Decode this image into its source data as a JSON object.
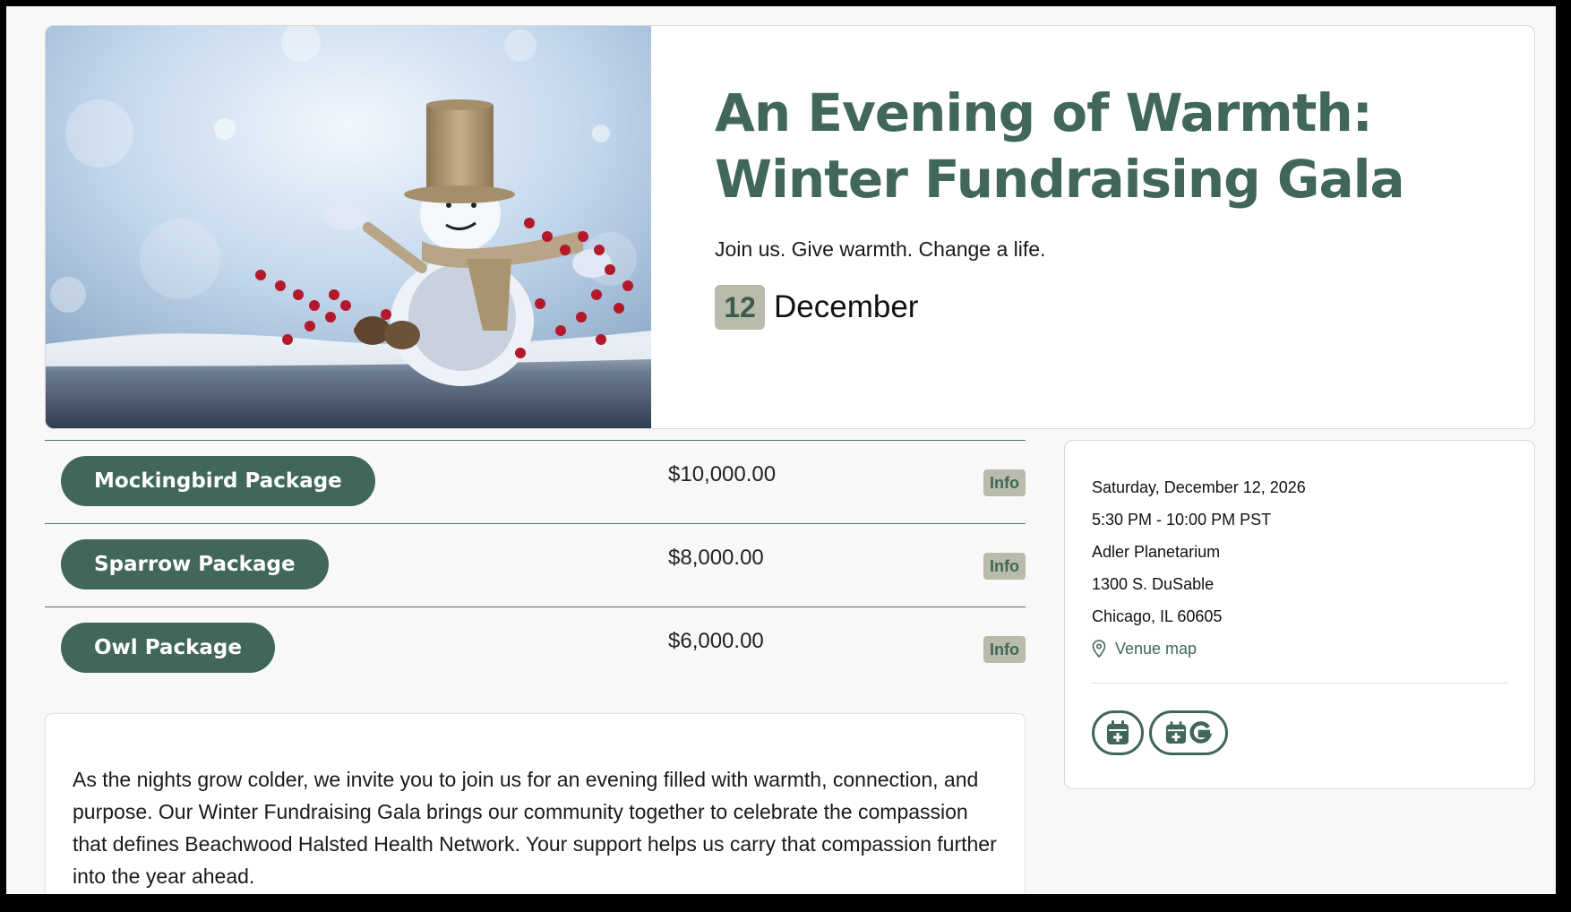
{
  "hero": {
    "title_line1": "An Evening of Warmth:",
    "title_line2": "Winter Fundraising Gala",
    "tagline": "Join us. Give warmth. Change a life.",
    "date_day": "12",
    "date_month": "December"
  },
  "packages": [
    {
      "label": "Mockingbird Package",
      "price": "$10,000.00",
      "info": "Info"
    },
    {
      "label": "Sparrow Package",
      "price": "$8,000.00",
      "info": "Info"
    },
    {
      "label": "Owl Package",
      "price": "$6,000.00",
      "info": "Info"
    }
  ],
  "description": "As the nights grow colder, we invite you to join us for an evening filled with warmth, connection, and purpose. Our Winter Fundraising Gala brings our community together to celebrate the compassion that defines Beachwood Halsted Health Network. Your support helps us carry that compassion further into the year ahead.",
  "details": {
    "date": "Saturday, December 12, 2026",
    "time": "5:30 PM - 10:00 PM PST",
    "venue": "Adler Planetarium",
    "address1": "1300 S. DuSable",
    "address2": "Chicago, IL 60605",
    "map_link": "Venue map",
    "calendar_buttons": [
      {
        "icon": "calendar-add-icon"
      },
      {
        "icon": "google-calendar-add-icon"
      }
    ]
  },
  "colors": {
    "brand_green": "#406757",
    "badge_tan": "#b9bcaa"
  }
}
